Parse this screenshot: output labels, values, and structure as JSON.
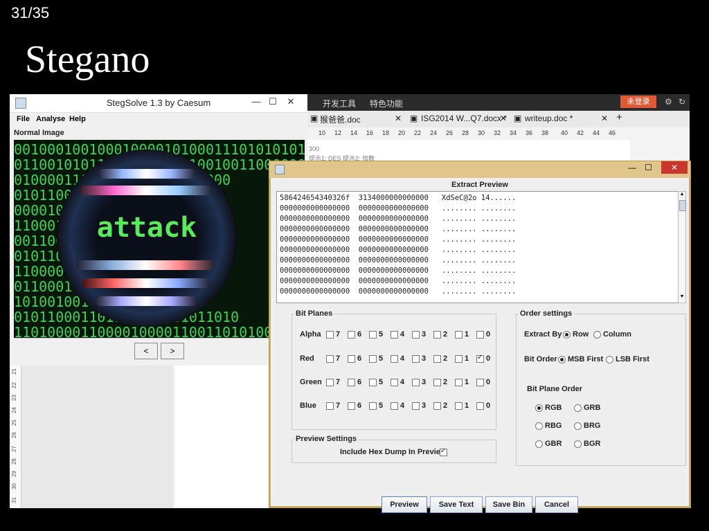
{
  "slide": {
    "counter": "31/35",
    "title": "Stegano"
  },
  "stegsolve": {
    "title": "StegSolve 1.3 by Caesum",
    "menu": [
      "File",
      "Analyse",
      "Help"
    ],
    "view_label": "Normal Image",
    "image_text": "attack",
    "binary_rows": [
      "00100010010001000010100011101010101110001",
      "01100101011      10111000110010011000000",
      "010000110             1001000000010000",
      "0101100                  110000101001",
      "000010                    11000010110",
      "110001                    1001101100",
      "001100                    001110111",
      "0101100                   101110110",
      "1100000                    1011101001",
      "0110001                  0110000110",
      "1010010011              1100011001",
      "01011000110110          101101011010",
      "11010000110000100001100110101000110001"
    ],
    "nav_prev": "<",
    "nav_next": ">",
    "ruler_numbers": [
      "21",
      "22",
      "23",
      "24",
      "25",
      "26",
      "27",
      "28",
      "29",
      "30",
      "31"
    ]
  },
  "word": {
    "toolbar": {
      "dev_tools": "开发工具",
      "features": "特色功能",
      "login": "未登录"
    },
    "tabs": [
      "猴爸爸.doc",
      "ISG2014 W...Q7.docx *",
      "writeup.doc *"
    ],
    "ruler": [
      "10",
      "12",
      "14",
      "16",
      "18",
      "20",
      "22",
      "24",
      "26",
      "28",
      "30",
      "32",
      "34",
      "36",
      "38",
      "40",
      "42",
      "44",
      "46"
    ],
    "doc_lines": [
      "300",
      "提示1: DES 提示2: 加数"
    ]
  },
  "extract": {
    "label": "Extract Preview",
    "hex_lines": [
      "586424654340326f  3134000000000000   XdSeC@2o 14......",
      "0000000000000000  0000000000000000   ........ ........",
      "0000000000000000  0000000000000000   ........ ........",
      "0000000000000000  0000000000000000   ........ ........",
      "0000000000000000  0000000000000000   ........ ........",
      "0000000000000000  0000000000000000   ........ ........",
      "0000000000000000  0000000000000000   ........ ........",
      "0000000000000000  0000000000000000   ........ ........",
      "0000000000000000  0000000000000000   ........ ........",
      "0000000000000000  0000000000000000   ........ ........"
    ],
    "bit_planes": {
      "title": "Bit Planes",
      "rows": [
        {
          "name": "Alpha",
          "checked": []
        },
        {
          "name": "Red",
          "checked": [
            "0"
          ]
        },
        {
          "name": "Green",
          "checked": []
        },
        {
          "name": "Blue",
          "checked": []
        }
      ],
      "bits": [
        "7",
        "6",
        "5",
        "4",
        "3",
        "2",
        "1",
        "0"
      ]
    },
    "order": {
      "title": "Order settings",
      "extract_by_label": "Extract By",
      "extract_by": [
        "Row",
        "Column"
      ],
      "extract_by_selected": "Row",
      "bit_order_label": "Bit Order",
      "bit_order": [
        "MSB First",
        "LSB First"
      ],
      "bit_order_selected": "MSB First",
      "plane_order_label": "Bit Plane Order",
      "plane_order": [
        "RGB",
        "GRB",
        "RBG",
        "BRG",
        "GBR",
        "BGR"
      ],
      "plane_order_selected": "RGB"
    },
    "preview_settings": {
      "title": "Preview Settings",
      "hex_dump_label": "Include Hex Dump In Preview",
      "hex_dump_checked": true
    },
    "buttons": {
      "preview": "Preview",
      "save_text": "Save Text",
      "save_bin": "Save Bin",
      "cancel": "Cancel"
    }
  }
}
